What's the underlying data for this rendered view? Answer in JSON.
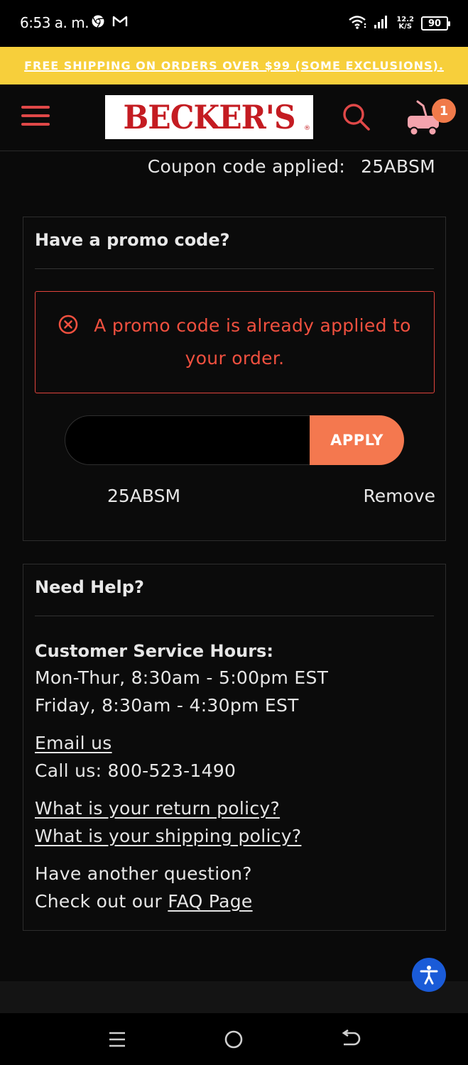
{
  "status_bar": {
    "time": "6:53 a. m.",
    "net_speed_value": "12.2",
    "net_speed_unit": "K/S",
    "battery": "90"
  },
  "banner": {
    "text": "FREE SHIPPING ON ORDERS OVER $99 (SOME EXCLUSIONS)."
  },
  "header": {
    "logo_text": "BECKER'S",
    "logo_mark": "®",
    "cart_count": "1"
  },
  "coupon": {
    "label": "Coupon code applied:",
    "code": "25ABSM"
  },
  "promo": {
    "title": "Have a promo code?",
    "error": "A promo code is already applied to your order.",
    "input_value": "",
    "input_placeholder": "",
    "apply_label": "APPLY",
    "applied_code": "25ABSM",
    "remove_label": "Remove"
  },
  "help": {
    "title": "Need Help?",
    "hours_label": "Customer Service Hours:",
    "hours_weekday": "Mon-Thur, 8:30am - 5:00pm EST",
    "hours_friday": "Friday, 8:30am - 4:30pm EST",
    "email_link": "Email us",
    "call_text": "Call us: 800-523-1490",
    "return_link": "What is your return policy?",
    "shipping_link": "What is your shipping policy?",
    "question_text": "Have another question?",
    "faq_prefix": "Check out our",
    "faq_link": "FAQ Page"
  },
  "colors": {
    "banner": "#f7cf3b",
    "accent": "#f4784f",
    "brand_red": "#c41c22",
    "error": "#f0503f",
    "a11y": "#1a5bd8"
  }
}
